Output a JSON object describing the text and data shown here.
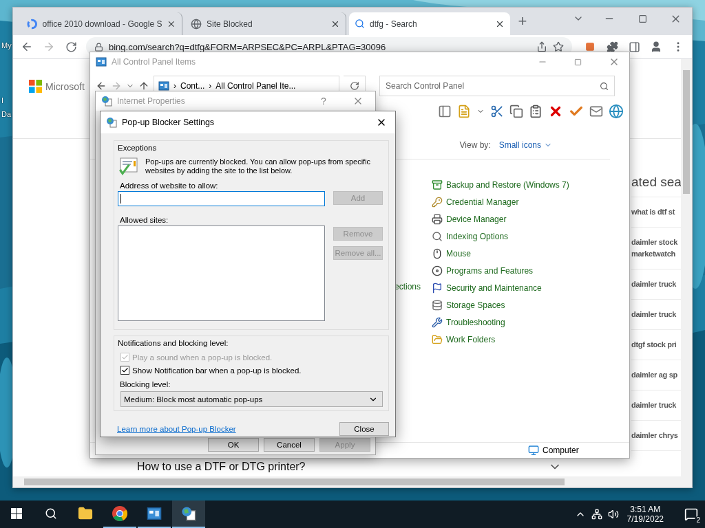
{
  "desktop": {
    "icon_labels": [
      "My",
      "I",
      "Da"
    ]
  },
  "browser": {
    "tabs": [
      {
        "title": "office 2010 download - Google S",
        "selected": false
      },
      {
        "title": "Site Blocked",
        "selected": false
      },
      {
        "title": "dtfg - Search",
        "selected": true
      }
    ],
    "new_tab": "+",
    "address": "bing.com/search?q=dtfg&FORM=ARPSEC&PC=ARPL&PTAG=30096",
    "page": {
      "logo": "Microsoft",
      "related_heading": "ated sea",
      "related": [
        "what is dtf st",
        "daimler stock\nmarketwatch",
        "daimler truck",
        "daimler truck",
        "dtgf stock pri",
        "daimler ag sp",
        "daimler truck",
        "daimler chrys"
      ],
      "question": "How to use a DTF or DTG printer?"
    }
  },
  "control_panel": {
    "title": "All Control Panel Items",
    "breadcrumb": [
      "›",
      "Cont...",
      "›",
      "All Control Panel Ite..."
    ],
    "search": {
      "placeholder": "Search Control Panel"
    },
    "view_by_label": "View by:",
    "view_by_value": "Small icons",
    "cut_item": "ections",
    "items": [
      "Backup and Restore (Windows 7)",
      "Credential Manager",
      "Device Manager",
      "Indexing Options",
      "Mouse",
      "Programs and Features",
      "Security and Maintenance",
      "Storage Spaces",
      "Troubleshooting",
      "Work Folders"
    ],
    "status": "Computer"
  },
  "internet_properties": {
    "title": "Internet Properties",
    "help": "?",
    "buttons": [
      {
        "label": "OK",
        "disabled": false
      },
      {
        "label": "Cancel",
        "disabled": false
      },
      {
        "label": "Apply",
        "disabled": true
      }
    ]
  },
  "popup_dialog": {
    "title": "Pop-up Blocker Settings",
    "exceptions": {
      "legend": "Exceptions",
      "info": "Pop-ups are currently blocked.  You can allow pop-ups from specific websites by adding the site to the list below.",
      "address_label": "Address of website to allow:",
      "address_field": {
        "focused": true
      },
      "add_button": {
        "label": "Add",
        "disabled": true
      },
      "allowed_label": "Allowed sites:",
      "list_buttons": [
        {
          "label": "Remove",
          "disabled": true
        },
        {
          "label": "Remove all...",
          "disabled": true
        }
      ]
    },
    "notifications": {
      "legend": "Notifications and blocking level:",
      "options": [
        {
          "label": "Play a sound when a pop-up is blocked.",
          "checked": true,
          "disabled": true
        },
        {
          "label": "Show Notification bar when a pop-up is blocked.",
          "checked": true,
          "disabled": false
        }
      ],
      "blocking_label": "Blocking level:",
      "blocking_value": "Medium: Block most automatic pop-ups"
    },
    "learn_more": "Learn more about Pop-up Blocker",
    "close_button": "Close"
  },
  "taskbar": {
    "apps": [
      {
        "selected": false,
        "open": false
      },
      {
        "selected": false,
        "open": true
      },
      {
        "selected": false,
        "open": true
      },
      {
        "selected": true,
        "open": true
      }
    ],
    "time": "3:51 AM",
    "date": "7/19/2022",
    "notifications": "2"
  }
}
